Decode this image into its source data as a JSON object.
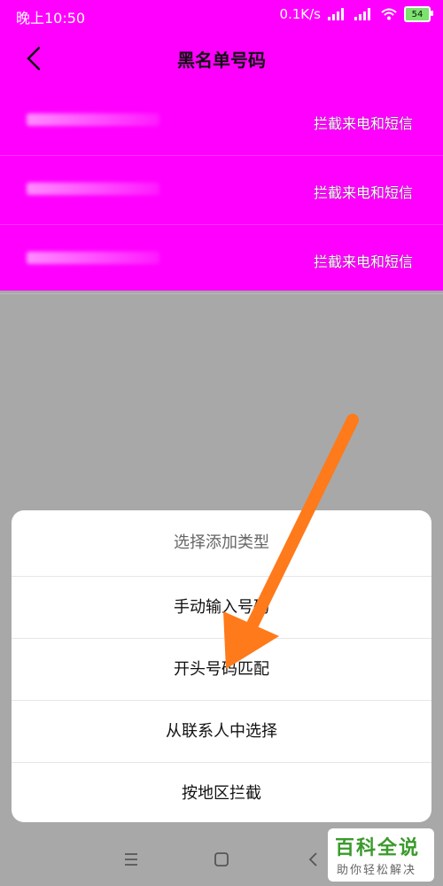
{
  "status_bar": {
    "time": "晚上10:50",
    "network_speed": "0.1K/s",
    "battery": "54"
  },
  "header": {
    "title": "黑名单号码"
  },
  "blacklist": [
    {
      "rule": "拦截来电和短信"
    },
    {
      "rule": "拦截来电和短信"
    },
    {
      "rule": "拦截来电和短信"
    }
  ],
  "sheet": {
    "title": "选择添加类型",
    "options": [
      {
        "label": "手动输入号码"
      },
      {
        "label": "开头号码匹配"
      },
      {
        "label": "从联系人中选择"
      },
      {
        "label": "按地区拦截"
      }
    ]
  },
  "watermark": {
    "main": "百科全说",
    "sub": "助你轻松解决"
  },
  "colors": {
    "header_bg": "#ff00ff",
    "overlay_bg": "#a8a8a8",
    "arrow": "#ff7a1a"
  }
}
